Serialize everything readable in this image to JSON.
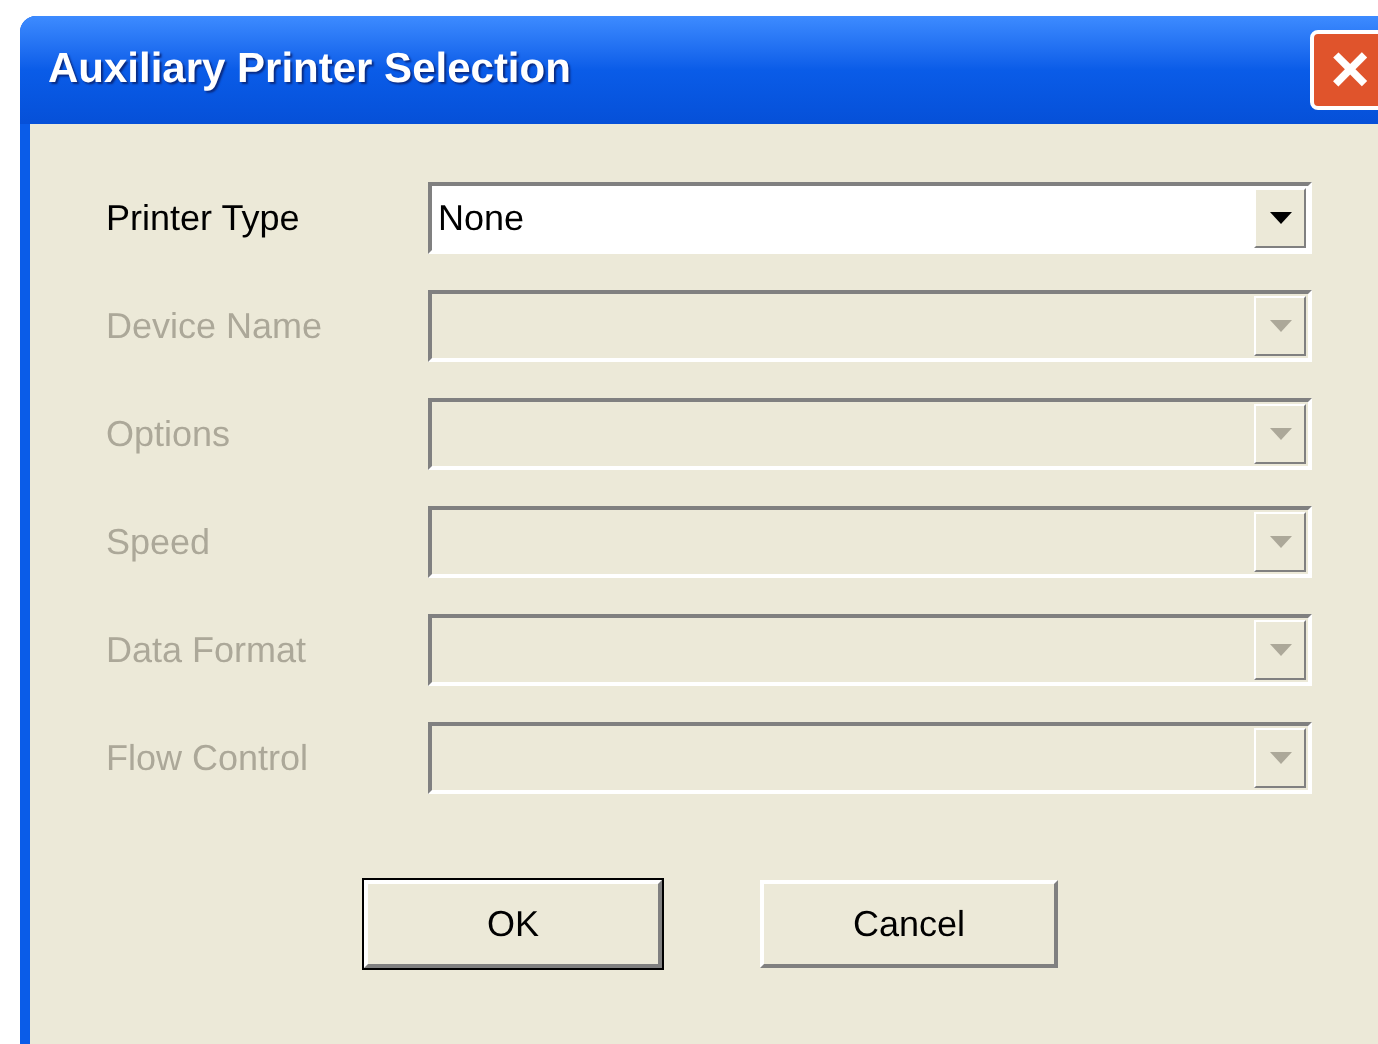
{
  "window": {
    "title": "Auxiliary Printer Selection",
    "close": "×"
  },
  "fields": [
    {
      "label": "Printer Type",
      "value": "None",
      "disabled": false
    },
    {
      "label": "Device Name",
      "disabled": true
    },
    {
      "label": "Options",
      "disabled": true
    },
    {
      "label": "Speed",
      "disabled": true
    },
    {
      "label": "Data Format",
      "disabled": true
    },
    {
      "label": "Flow Control",
      "disabled": true
    }
  ],
  "buttons": [
    {
      "label": "OK",
      "default": true
    },
    {
      "label": "Cancel",
      "default": false
    }
  ]
}
